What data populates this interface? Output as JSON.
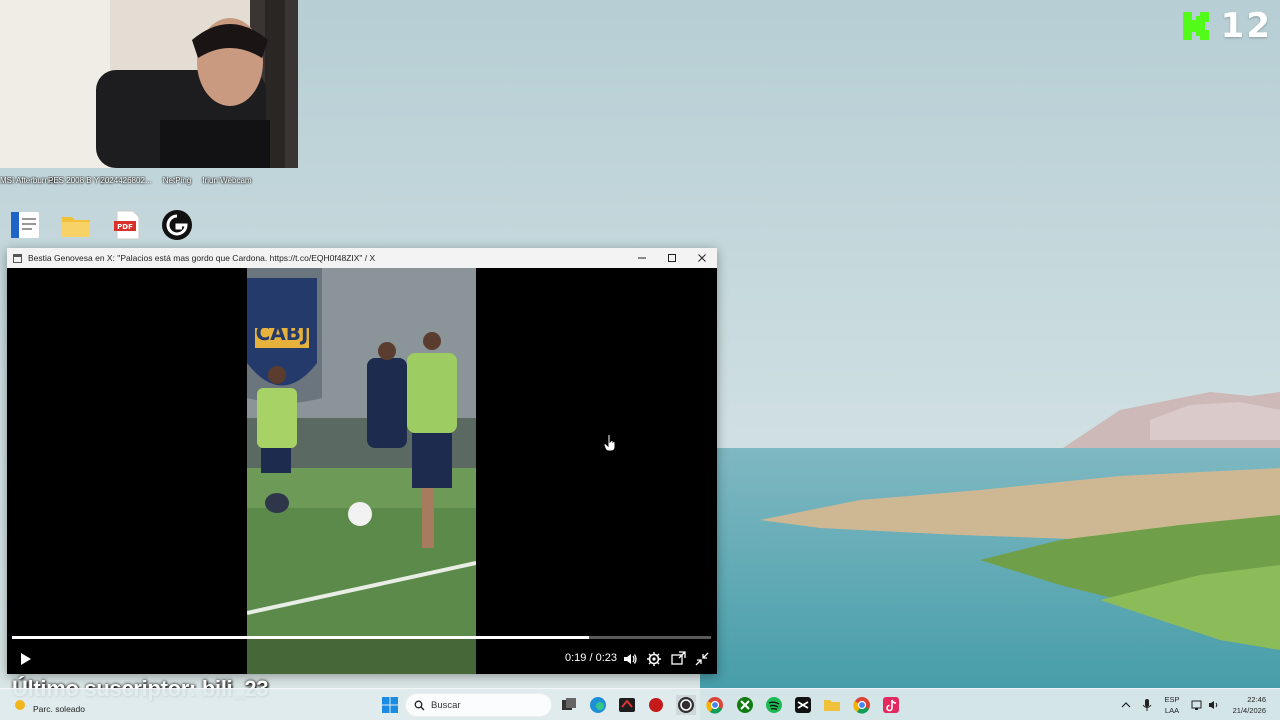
{
  "kick": {
    "label": "12",
    "icon": "kick-logo-icon",
    "color": "#53fc18"
  },
  "webcam": {
    "label": "webcam-feed"
  },
  "desktop": {
    "top_labels": [
      {
        "label": "MSI Afterburner"
      },
      {
        "label": "PES 2008 B Y HD NIKE..."
      },
      {
        "label": "2024426802..."
      },
      {
        "label": "NetPing"
      },
      {
        "label": "Iriun Webcam"
      }
    ]
  },
  "video_window": {
    "title": "Bestia Genovesa en X: \"Palacios está mas gordo que Cardona. https://t.co/EQH0f48ZIX\" / X",
    "time_display": "0:19 / 0:23",
    "progress": 0.826,
    "crest_text": "CABJ"
  },
  "overlay": {
    "subscriber_text": "Último suscriptor: bili_23"
  },
  "taskbar": {
    "weather": "Parc. soleado",
    "search_placeholder": "Buscar",
    "lang_top": "ESP",
    "lang_bottom": "LAA",
    "time": "22:46",
    "date": "21/4/2026"
  },
  "colors": {
    "accent": "#0a66c2",
    "progress": "#ffffff"
  }
}
